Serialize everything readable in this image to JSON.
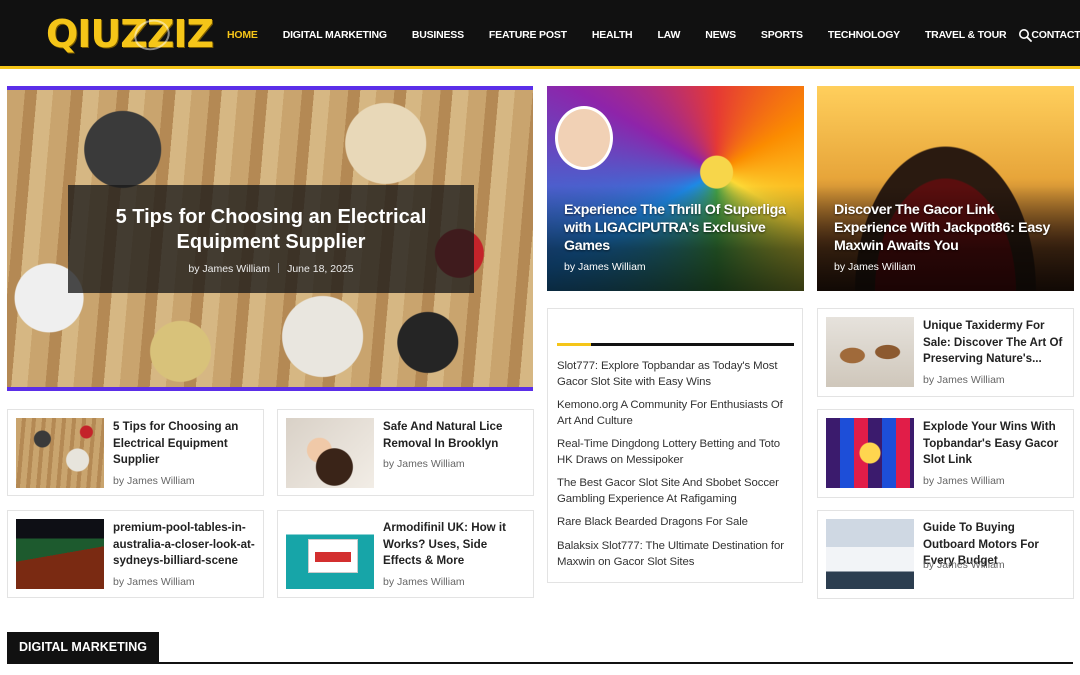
{
  "site": {
    "logo_text": "QIUZZIZ"
  },
  "nav": {
    "items": [
      "HOME",
      "DIGITAL MARKETING",
      "BUSINESS",
      "FEATURE POST",
      "HEALTH",
      "LAW",
      "NEWS",
      "SPORTS",
      "TECHNOLOGY",
      "TRAVEL & TOUR",
      "CONTACT"
    ],
    "active": "HOME"
  },
  "hero": {
    "title": "5 Tips for Choosing an Electrical Equipment Supplier",
    "author": "by James William",
    "date": "June 18, 2025"
  },
  "top_cards": [
    {
      "title": "Experience The Thrill Of Superliga with LIGACIPUTRA's Exclusive Games",
      "author": "by James William"
    },
    {
      "title": "Discover The Gacor Link Experience With Jackpot86: Easy Maxwin Awaits You",
      "author": "by James William"
    }
  ],
  "left_cards": [
    {
      "title": "5 Tips for Choosing an Electrical Equipment Supplier",
      "author": "by James William"
    },
    {
      "title": "Safe And Natural Lice Removal In Brooklyn",
      "author": "by James William"
    },
    {
      "title": "premium-pool-tables-in-australia-a-closer-look-at-sydneys-billiard-scene",
      "author": "by James William"
    },
    {
      "title": "Armodifinil UK: How it Works? Uses, Side Effects & More",
      "author": "by James William"
    }
  ],
  "list": {
    "items": [
      "Slot777: Explore Topbandar as Today's Most Gacor Slot Site with Easy Wins",
      "Kemono.org A Community For Enthusiasts Of Art And Culture",
      "Real-Time Dingdong Lottery Betting and Toto HK Draws on Messipoker",
      "The Best Gacor Slot Site And Sbobet Soccer Gambling Experience At Rafigaming",
      "Rare Black Bearded Dragons For Sale",
      "Balaksix Slot777: The Ultimate Destination for Maxwin on Gacor Slot Sites"
    ]
  },
  "right_cards": [
    {
      "title": "Unique Taxidermy For Sale: Discover The Art Of Preserving Nature's...",
      "author": "by James William"
    },
    {
      "title": "Explode Your Wins With Topbandar's Easy Gacor Slot Link",
      "author": "by James William"
    },
    {
      "title": "Guide To Buying Outboard Motors For Every Budget",
      "author": "by James William"
    }
  ],
  "section": {
    "title": "DIGITAL MARKETING"
  },
  "colors": {
    "accent": "#f5c518",
    "hero_border": "#5b2ee8",
    "header_bg": "#111111"
  },
  "icons": {
    "search": "search-icon"
  }
}
